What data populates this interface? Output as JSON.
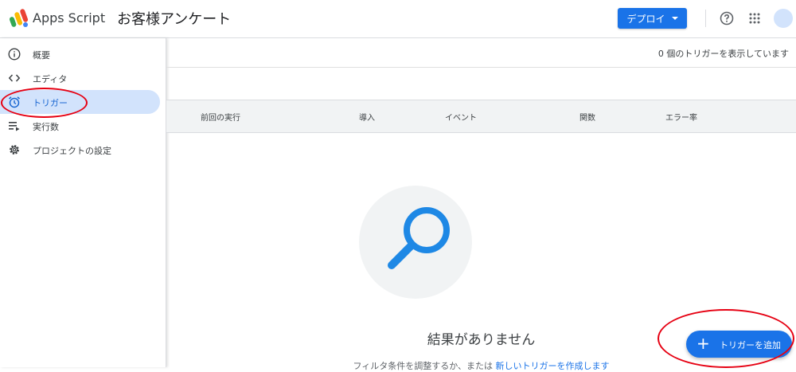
{
  "header": {
    "app_name": "Apps Script",
    "project_title": "お客様アンケート",
    "deploy_label": "デプロイ"
  },
  "sidebar": {
    "items": [
      {
        "label": "概要",
        "icon": "info-icon"
      },
      {
        "label": "エディタ",
        "icon": "code-icon"
      },
      {
        "label": "トリガー",
        "icon": "alarm-clock-icon",
        "active": true
      },
      {
        "label": "実行数",
        "icon": "executions-icon"
      },
      {
        "label": "プロジェクトの設定",
        "icon": "gear-icon"
      }
    ]
  },
  "main": {
    "count_text": "0 個のトリガーを表示しています",
    "columns": [
      "前回の実行",
      "導入",
      "イベント",
      "関数",
      "エラー率"
    ],
    "empty_title": "結果がありません",
    "empty_desc": "フィルタ条件を調整するか、または",
    "empty_link": "新しいトリガーを作成します"
  },
  "fab": {
    "label": "トリガーを追加"
  },
  "colors": {
    "accent": "#1a73e8",
    "active_nav_bg": "#d2e3fc",
    "annotation": "#e60012"
  }
}
